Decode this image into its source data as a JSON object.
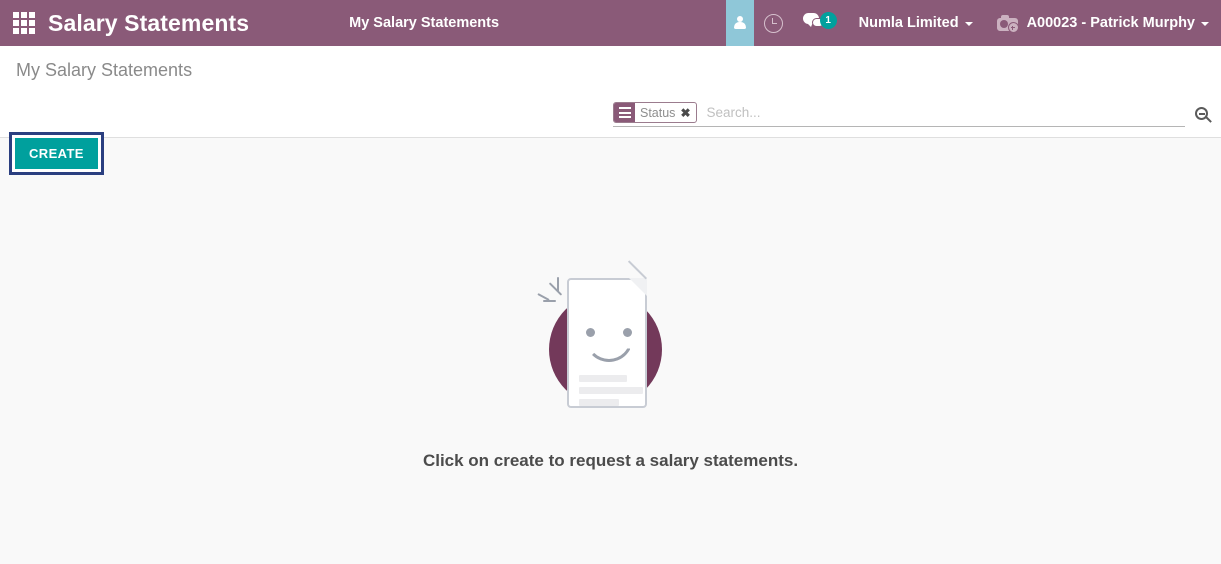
{
  "navbar": {
    "apps_icon": "apps-grid-icon",
    "brand": "Salary Statements",
    "breadcrumb": "My Salary Statements",
    "user_icon": "person-icon",
    "activity_icon": "clock-icon",
    "messaging_icon": "chat-bubble-icon",
    "messaging_badge": "1",
    "company": "Numla Limited",
    "avatar_icon": "camera-add-icon",
    "username": "A00023 - Patrick Murphy",
    "bg_color": "#8a5a78",
    "user_block_color": "#8fc7d8",
    "badge_color": "#00a09d"
  },
  "control_panel": {
    "title": "My Salary Statements",
    "create_label": "CREATE",
    "create_color": "#00a09d",
    "highlight_color": "#2b3f80"
  },
  "search": {
    "facet_icon": "filter-lines-icon",
    "facet_label": "Status",
    "facet_remove_icon": "close-x-icon",
    "placeholder": "Search...",
    "value": "",
    "search_icon": "search-icon"
  },
  "empty_state": {
    "illustration": "smiling-document-icon",
    "circle_color": "#73395a",
    "caption": "Click on create to request a salary statements."
  }
}
